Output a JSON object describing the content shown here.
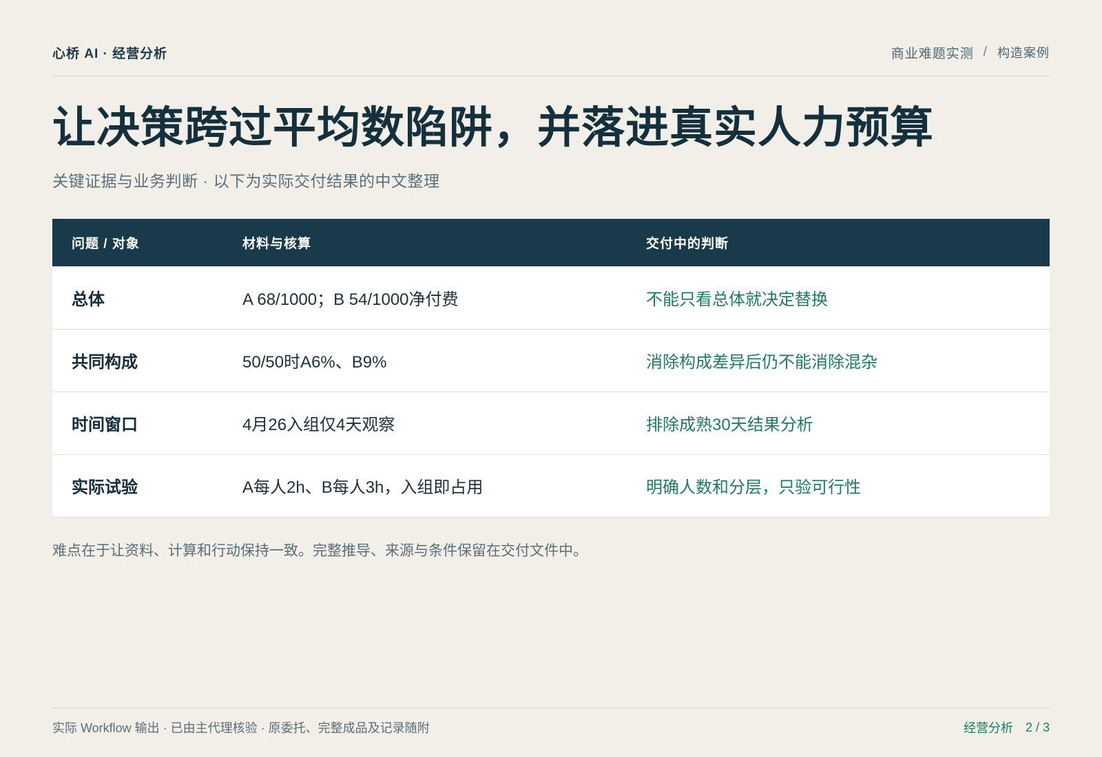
{
  "header": {
    "brand": "心桥 AI · 经营分析",
    "breadcrumb": [
      "商业难题实测",
      "构造案例"
    ],
    "breadcrumb_separator": "/"
  },
  "title": "让决策跨过平均数陷阱，并落进真实人力预算",
  "subtitle": "关键证据与业务判断 · 以下为实际交付结果的中文整理",
  "table": {
    "columns": [
      "问题 / 对象",
      "材料与核算",
      "交付中的判断"
    ],
    "rows": [
      [
        "总体",
        "A 68/1000；B 54/1000净付费",
        "不能只看总体就决定替换"
      ],
      [
        "共同构成",
        "50/50时A6%、B9%",
        "消除构成差异后仍不能消除混杂"
      ],
      [
        "时间窗口",
        "4月26入组仅4天观察",
        "排除成熟30天结果分析"
      ],
      [
        "实际试验",
        "A每人2h、B每人3h，入组即占用",
        "明确人数和分层，只验可行性"
      ]
    ]
  },
  "note": "难点在于让资料、计算和行动保持一致。完整推导、来源与条件保留在交付文件中。",
  "footer": {
    "left": "实际 Workflow 输出 · 已由主代理核验 · 原委托、完整成品及记录随附",
    "section": "经营分析",
    "pager": "2 / 3"
  },
  "colors": {
    "background": "#f2efe9",
    "table_header": "#183a4a",
    "accent_green": "#1f7a62",
    "title": "#15303d"
  }
}
